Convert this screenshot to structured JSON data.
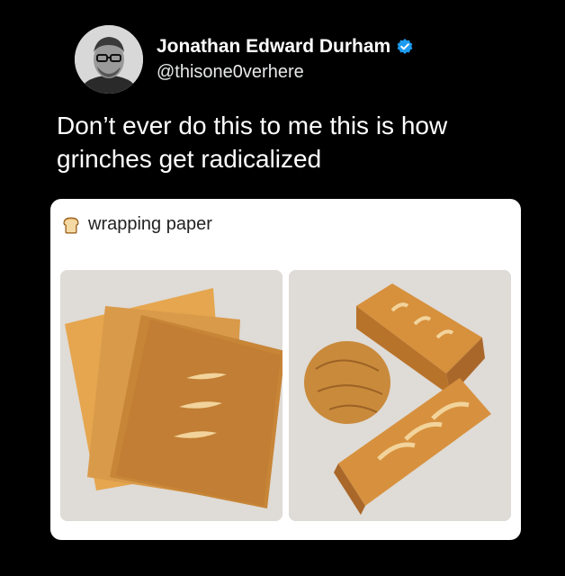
{
  "author": {
    "name": "Jonathan Edward Durham",
    "handle": "@thisone0verhere",
    "verified": true,
    "verified_badge_icon": "verified-badge-icon",
    "verified_color": "#1d9bf0"
  },
  "tweet": {
    "text": "Don’t ever do this to me this is how grinches get radicalized"
  },
  "card": {
    "title": "wrapping paper",
    "title_icon": "bread-emoji-icon"
  },
  "colors": {
    "background": "#000000",
    "card_background": "#ffffff",
    "bread_tan": "#c98a3b"
  }
}
